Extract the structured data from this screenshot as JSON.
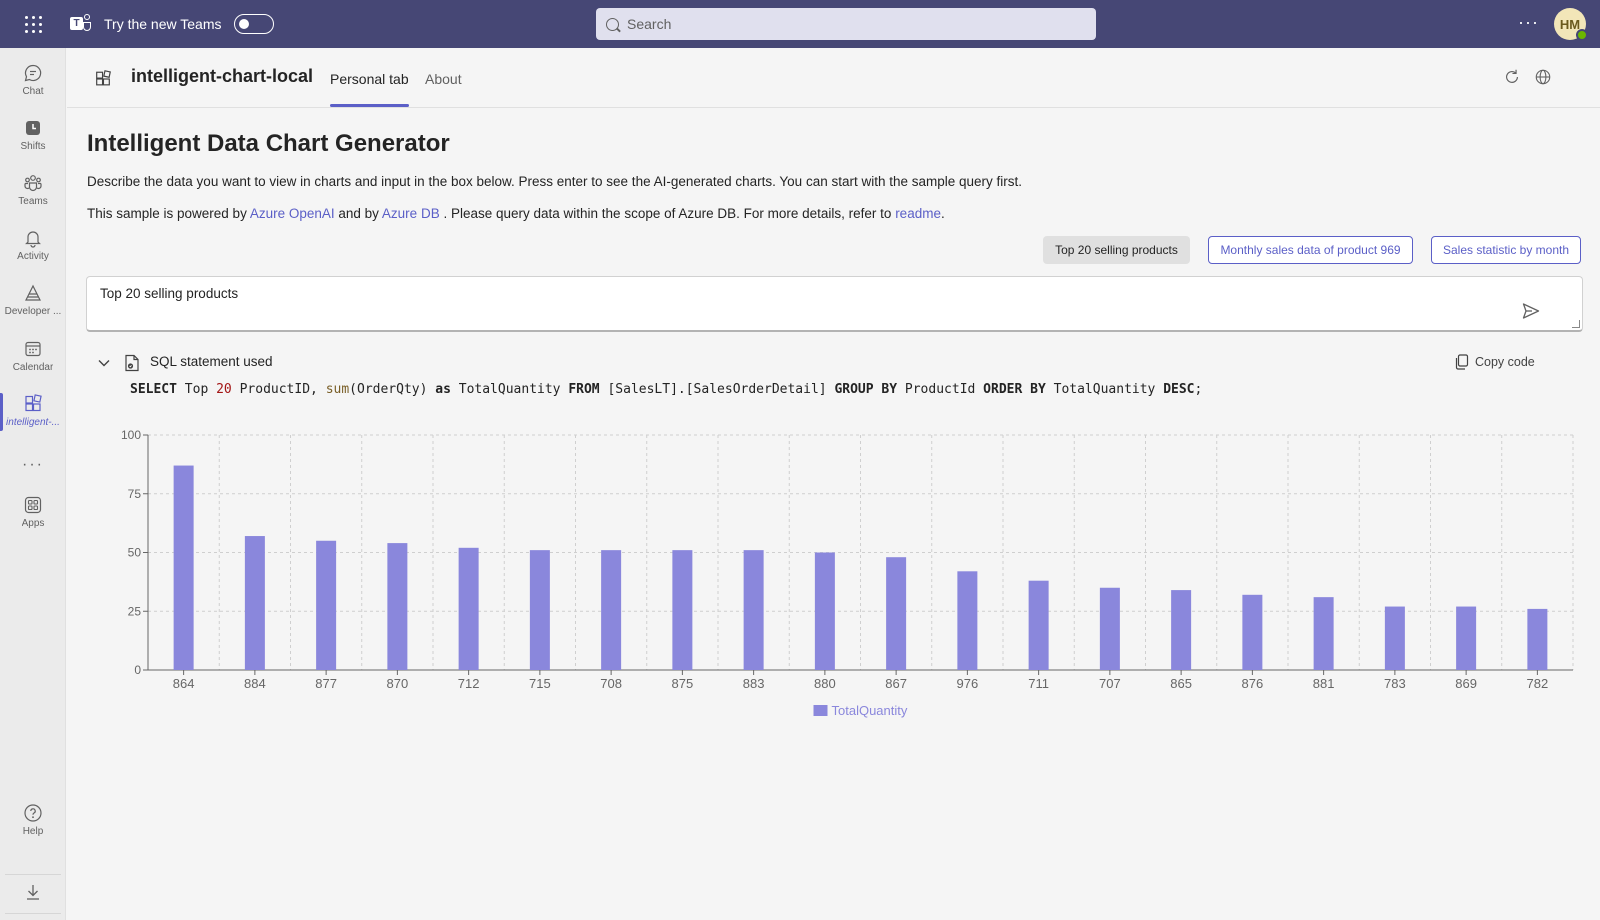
{
  "topbar": {
    "try_label": "Try the new Teams",
    "search_placeholder": "Search",
    "more": "···",
    "avatar_initials": "HM"
  },
  "rail": {
    "items": [
      {
        "label": "Chat",
        "icon": "chat-icon"
      },
      {
        "label": "Shifts",
        "icon": "shifts-icon"
      },
      {
        "label": "Teams",
        "icon": "teams-icon"
      },
      {
        "label": "Activity",
        "icon": "bell-icon"
      },
      {
        "label": "Developer ...",
        "icon": "developer-portal-icon"
      },
      {
        "label": "Calendar",
        "icon": "calendar-icon"
      },
      {
        "label": "intelligent-...",
        "icon": "app-grid-icon"
      },
      {
        "label": "Apps",
        "icon": "apps-icon"
      },
      {
        "label": "Help",
        "icon": "help-icon"
      }
    ],
    "more": "···"
  },
  "tabheader": {
    "app_title": "intelligent-chart-local",
    "tabs": [
      "Personal tab",
      "About"
    ]
  },
  "main": {
    "title": "Intelligent Data Chart Generator",
    "description": "Describe the data you want to view in charts and input in the box below. Press enter to see the AI-generated charts. You can start with the sample query first.",
    "powered": {
      "p1": "This sample is powered by ",
      "link1": "Azure OpenAI",
      "p2": " and by ",
      "link2": "Azure DB",
      "p3": " . Please query data within the scope of Azure DB. For more details, refer to ",
      "link3": "readme",
      "p4": "."
    },
    "chips": [
      "Top 20 selling products",
      "Monthly sales data of product 969",
      "Sales statistic by month"
    ],
    "query_value": "Top 20 selling products",
    "sql_label": "SQL statement used",
    "copy_label": "Copy code",
    "sql": {
      "t1": "SELECT",
      "t2": " Top ",
      "t3": "20",
      "t4": " ProductID, ",
      "t5": "sum",
      "t6": "(OrderQty) ",
      "t7": "as",
      "t8": " TotalQuantity ",
      "t9": "FROM",
      "t10": " [SalesLT].[SalesOrderDetail] ",
      "t11": "GROUP BY",
      "t12": " ProductId ",
      "t13": "ORDER BY",
      "t14": " TotalQuantity ",
      "t15": "DESC",
      "t16": ";"
    }
  },
  "colors": {
    "accent": "#5b5fc7",
    "bar": "#8a87dc",
    "header": "#464775"
  },
  "chart_data": {
    "type": "bar",
    "categories": [
      "864",
      "884",
      "877",
      "870",
      "712",
      "715",
      "708",
      "875",
      "883",
      "880",
      "867",
      "976",
      "711",
      "707",
      "865",
      "876",
      "881",
      "783",
      "869",
      "782"
    ],
    "series": [
      {
        "name": "TotalQuantity",
        "values": [
          87,
          57,
          55,
          54,
          52,
          51,
          51,
          51,
          51,
          50,
          48,
          42,
          38,
          35,
          34,
          32,
          31,
          27,
          27,
          26
        ]
      }
    ],
    "ylim": [
      0,
      100
    ],
    "yticks": [
      "0",
      "25",
      "50",
      "75",
      "100"
    ],
    "grid": true,
    "legend": "bottom"
  }
}
